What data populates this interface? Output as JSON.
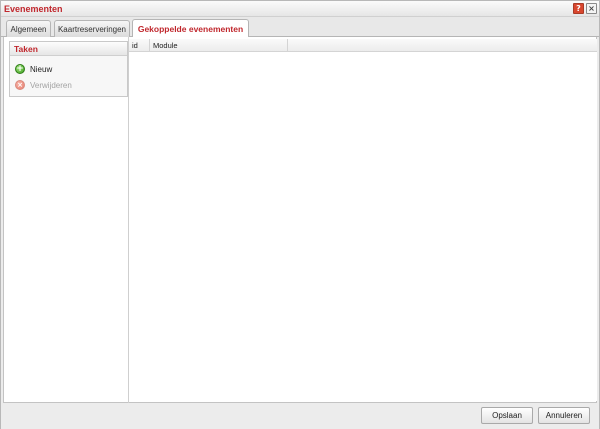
{
  "window": {
    "title": "Evenementen",
    "help_icon": "?",
    "close_icon": "×"
  },
  "tabs": [
    {
      "label": "Algemeen",
      "active": false
    },
    {
      "label": "Kaartreserveringen",
      "active": false
    },
    {
      "label": "Gekoppelde evenementen",
      "active": true
    }
  ],
  "tasks": {
    "title": "Taken",
    "items": [
      {
        "label": "Nieuw",
        "icon": "add-icon",
        "enabled": true
      },
      {
        "label": "Verwijderen",
        "icon": "remove-icon",
        "enabled": false
      }
    ]
  },
  "grid": {
    "columns": [
      "id",
      "Module"
    ],
    "rows": []
  },
  "footer": {
    "save_label": "Opslaan",
    "cancel_label": "Annuleren"
  },
  "colors": {
    "accent": "#c0272d",
    "disabled_text": "#a3a3a3"
  }
}
